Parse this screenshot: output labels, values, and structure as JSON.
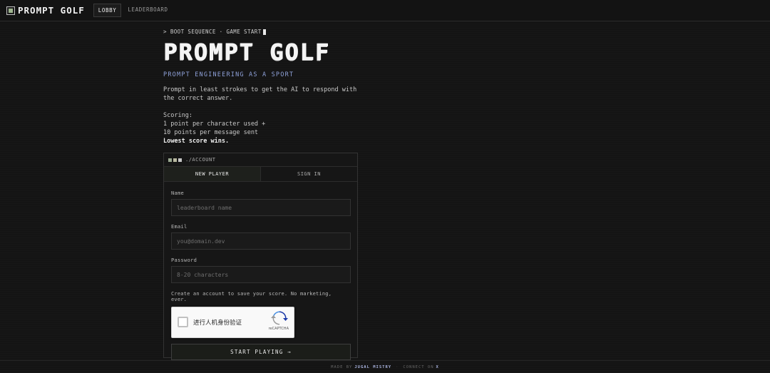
{
  "brand": {
    "name": "PROMPT GOLF",
    "icon": "golf-flag-icon"
  },
  "nav": {
    "tabs": [
      {
        "label": "LOBBY",
        "active": true
      },
      {
        "label": "LEADERBOARD",
        "active": false
      }
    ]
  },
  "hero": {
    "boot": "> BOOT SEQUENCE · GAME START",
    "title": "PROMPT GOLF",
    "tagline": "PROMPT ENGINEERING AS A SPORT",
    "description": "Prompt in least strokes to get the AI to respond with the correct answer.",
    "scoring_title": "Scoring:",
    "scoring_line1": "1 point per character used +",
    "scoring_line2": "10 points per message sent",
    "scoring_line3": "Lowest score wins."
  },
  "account": {
    "header": "./ACCOUNT",
    "tabs": [
      {
        "label": "NEW PLAYER",
        "active": true
      },
      {
        "label": "SIGN IN",
        "active": false
      }
    ],
    "fields": {
      "name_label": "Name",
      "name_placeholder": "leaderboard name",
      "email_label": "Email",
      "email_placeholder": "you@domain.dev",
      "password_label": "Password",
      "password_placeholder": "8-20 characters"
    },
    "hint": "Create an account to save your score. No marketing, ever.",
    "captcha_label": "进行人机身份验证",
    "captcha_brand": "reCAPTCHA",
    "start_label": "START PLAYING →"
  },
  "footer": {
    "made_by": "MADE BY",
    "author": "JUGAL MISTRY",
    "sep": "·",
    "connect": "CONNECT ON",
    "network": "X"
  },
  "colors": {
    "accent": "#8ea0d8",
    "background": "#141414",
    "dot_green": "#9aa890"
  }
}
